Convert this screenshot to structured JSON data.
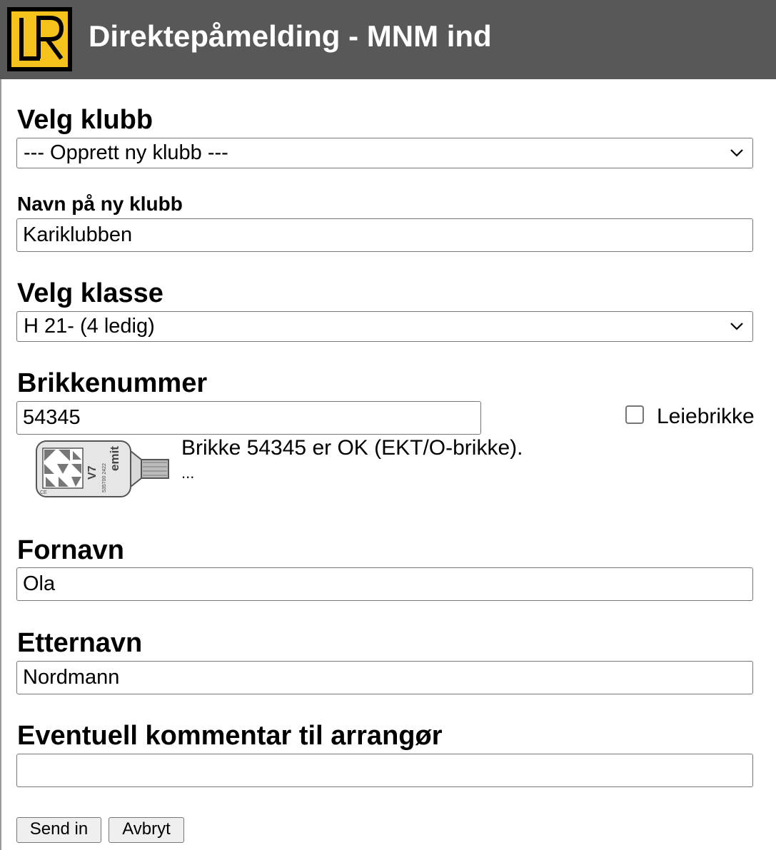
{
  "header": {
    "logo_text": "LR",
    "title": "Direktepåmelding - MNM ind"
  },
  "club": {
    "heading": "Velg klubb",
    "selected": "--- Opprett ny klubb ---"
  },
  "new_club": {
    "label": "Navn på ny klubb",
    "value": "Kariklubben"
  },
  "class": {
    "heading": "Velg klasse",
    "selected": "H 21- (4 ledig)"
  },
  "chip": {
    "heading": "Brikkenummer",
    "value": "54345",
    "rental_label": "Leiebrikke",
    "rental_checked": false,
    "status": "Brikke 54345 er OK (EKT/O-brikke).",
    "status_more": "...",
    "card_image": {
      "brand": "emit",
      "model": "V7",
      "serial": "535700 2422"
    }
  },
  "first_name": {
    "heading": "Fornavn",
    "value": "Ola"
  },
  "last_name": {
    "heading": "Etternavn",
    "value": "Nordmann"
  },
  "comment": {
    "heading": "Eventuell kommentar til arrangør",
    "value": ""
  },
  "buttons": {
    "submit": "Send in",
    "cancel": "Avbryt"
  }
}
